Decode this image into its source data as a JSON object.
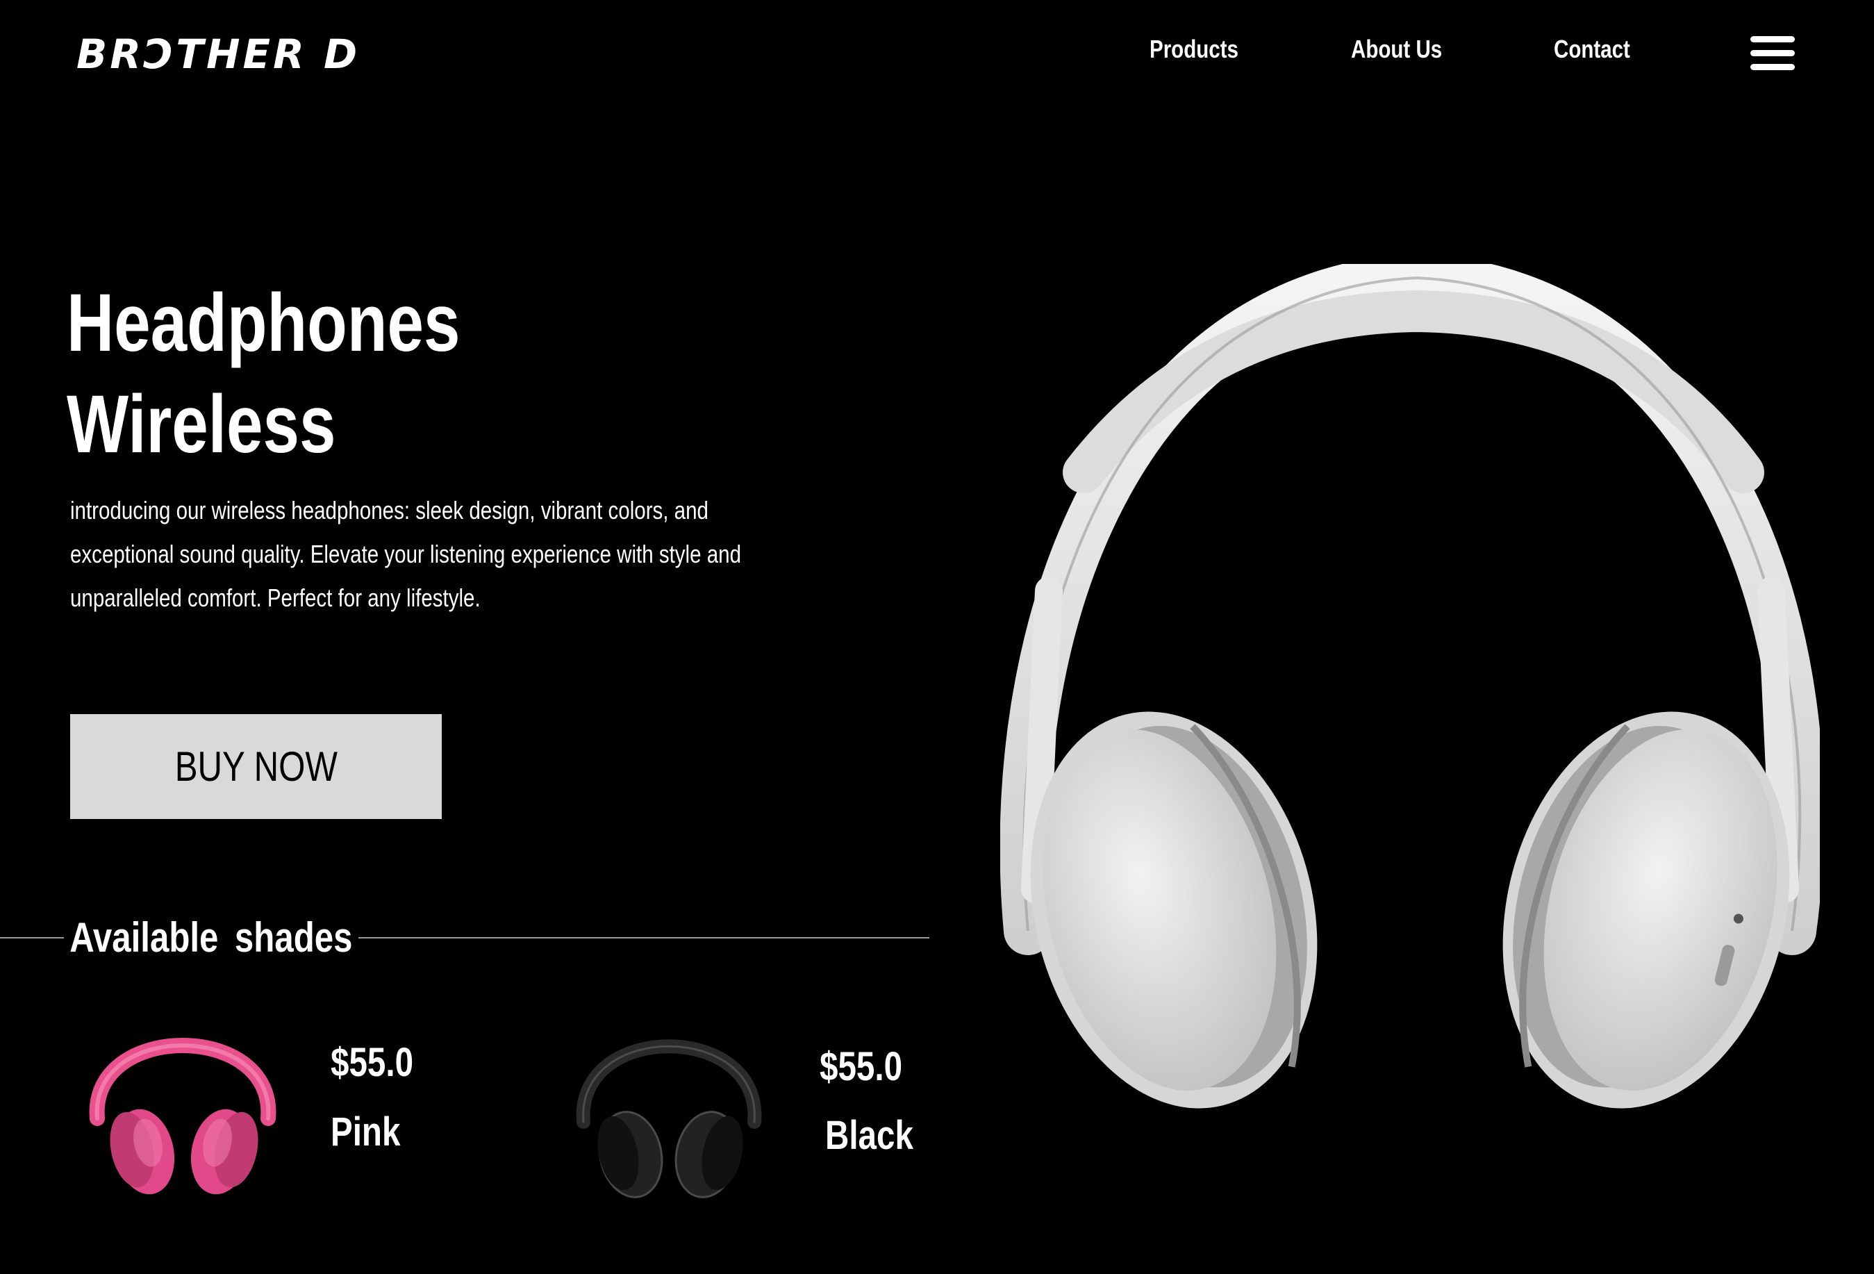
{
  "header": {
    "logo": "BRƆTHER D",
    "nav": [
      "Products",
      "About Us",
      "Contact"
    ],
    "menu_icon": "hamburger-menu-icon"
  },
  "hero": {
    "title_line1": "Headphones",
    "title_line2": "Wireless",
    "description": "introducing our wireless headphones: sleek design, vibrant colors, and exceptional sound quality. Elevate your listening experience with style and unparalleled comfort. Perfect for any lifestyle.",
    "cta_label": "BUY NOW",
    "product_image": "white-wireless-headphones-image"
  },
  "shades": {
    "heading": "Available  shades",
    "items": [
      {
        "price": "$55.0",
        "color_name": "Pink",
        "image": "pink-headphones-image",
        "color": "#e8508e"
      },
      {
        "price": "$55.0",
        "color_name": "Black",
        "image": "black-headphones-image",
        "color": "#1e1e1e"
      }
    ]
  },
  "colors": {
    "background": "#000000",
    "text": "#ffffff",
    "button_bg": "#d9d9d9",
    "divider": "#9a9a9a"
  }
}
